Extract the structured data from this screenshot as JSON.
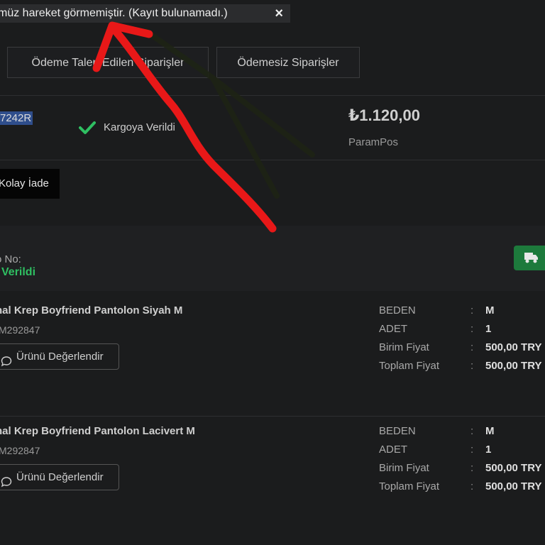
{
  "toast": {
    "message": "müz hareket görmemiştir. (Kayıt bulunamadı.)",
    "close": "×"
  },
  "tabs": [
    {
      "label": "Ödeme Talep Edilen Siparişler"
    },
    {
      "label": "Ödemesiz Siparişler"
    }
  ],
  "order": {
    "number": "7242R",
    "sub": "-",
    "status": "Kargoya Verildi",
    "price": "₺1.120,00",
    "payment_method": "ParamPos",
    "return_button": "Kolay İade"
  },
  "cargo": {
    "label": "o No:",
    "status": "Verildi"
  },
  "products": [
    {
      "name": "hal Krep Boyfriend Pantolon Siyah M",
      "code": "M292847",
      "rate_label": "Ürünü Değerlendir",
      "specs": [
        {
          "key": "BEDEN",
          "value": "M"
        },
        {
          "key": "ADET",
          "value": "1"
        },
        {
          "key": "Birim Fiyat",
          "value": "500,00 TRY"
        },
        {
          "key": "Toplam Fiyat",
          "value": "500,00 TRY"
        }
      ]
    },
    {
      "name": "hal Krep Boyfriend Pantolon Lacivert M",
      "code": "M292847",
      "rate_label": "Ürünü Değerlendir",
      "specs": [
        {
          "key": "BEDEN",
          "value": "M"
        },
        {
          "key": "ADET",
          "value": "1"
        },
        {
          "key": "Birim Fiyat",
          "value": "500,00 TRY"
        },
        {
          "key": "Toplam Fiyat",
          "value": "500,00 TRY"
        }
      ]
    }
  ],
  "colors": {
    "accent_green": "#2fbf62",
    "annotation_red": "#e81818"
  },
  "icons": [
    "close-icon",
    "check-icon",
    "truck-icon",
    "speech-bubble-icon"
  ]
}
